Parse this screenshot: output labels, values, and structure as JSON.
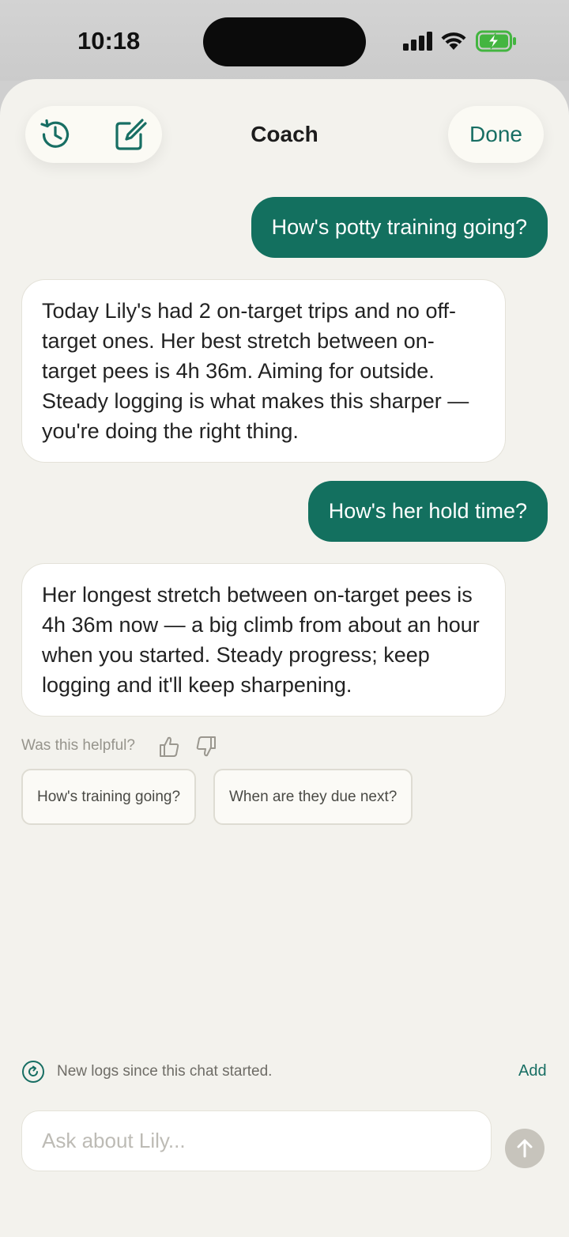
{
  "status_bar": {
    "time": "10:18",
    "icons": [
      "signal-icon",
      "wifi-icon",
      "battery-charging-icon"
    ]
  },
  "header": {
    "title": "Coach",
    "done_label": "Done",
    "left_icons": [
      "history-icon",
      "compose-icon"
    ]
  },
  "conversation": [
    {
      "role": "user",
      "text": "How's potty training going?"
    },
    {
      "role": "coach",
      "text": "Today Lily's had 2 on-target trips and no off-target ones. Her best stretch between on-target pees is 4h 36m. Aiming for outside. Steady logging is what makes this sharper — you're doing the right thing."
    },
    {
      "role": "user",
      "text": "How's her hold time?"
    },
    {
      "role": "coach",
      "text": "Her longest stretch between on-target pees is 4h 36m now — a big climb from about an hour when you started. Steady progress; keep logging and it'll keep sharpening."
    }
  ],
  "feedback": {
    "label": "Was this helpful?",
    "icons": [
      "thumbs-up-icon",
      "thumbs-down-icon"
    ]
  },
  "suggestions": [
    "How's training going?",
    "When are they due next?"
  ],
  "new_logs_notice": {
    "text": "New logs since this chat started.",
    "action_label": "Add",
    "icon": "refresh-icon"
  },
  "composer": {
    "placeholder": "Ask about Lily...",
    "value": "",
    "send_icon": "arrow-up-icon"
  },
  "colors": {
    "accent": "#13705f",
    "accent_text": "#176e63",
    "sheet_background": "#f3f2ed",
    "bubble_background": "#ffffff",
    "send_disabled": "#c7c4bc"
  }
}
